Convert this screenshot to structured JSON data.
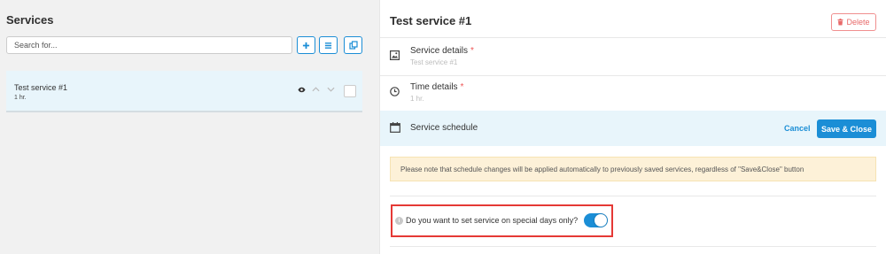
{
  "left": {
    "title": "Services",
    "search_placeholder": "Search for...",
    "toolbar": {
      "add_icon": "plus-icon",
      "list_icon": "list-icon",
      "copy_icon": "copy-icon"
    },
    "services": [
      {
        "name": "Test service #1",
        "duration": "1 hr."
      }
    ]
  },
  "right": {
    "title": "Test service #1",
    "delete_label": "Delete",
    "service_details": {
      "label": "Service details",
      "required": "*",
      "sub": "Test service #1"
    },
    "time_details": {
      "label": "Time details",
      "required": "*",
      "sub": "1 hr."
    },
    "schedule": {
      "label": "Service schedule",
      "cancel_label": "Cancel",
      "save_label": "Save & Close"
    },
    "notice": "Please note that schedule changes will be applied automatically to previously saved services, regardless of \"Save&Close\" button",
    "special_days": {
      "label": "Do you want to set service on special days only?",
      "enabled": true
    }
  },
  "colors": {
    "accent": "#1b8ed6",
    "danger": "#e86a6a",
    "highlight_border": "#e53935",
    "notice_bg": "#fdf1d8",
    "selected_bg": "#e8f5fb"
  }
}
